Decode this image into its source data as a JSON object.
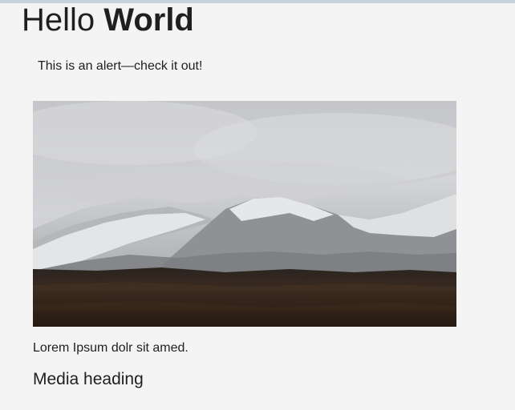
{
  "header": {
    "title_light": "Hello",
    "title_bold": "World"
  },
  "alert": {
    "text": "This is an alert—check it out!"
  },
  "media": {
    "image_icon": "landscape-photo",
    "caption": "Lorem Ipsum dolr sit amed.",
    "heading": "Media heading"
  },
  "colors": {
    "background": "#f4f4f4",
    "text": "#1f1f1f",
    "top_strip": "#c6d3dc"
  }
}
